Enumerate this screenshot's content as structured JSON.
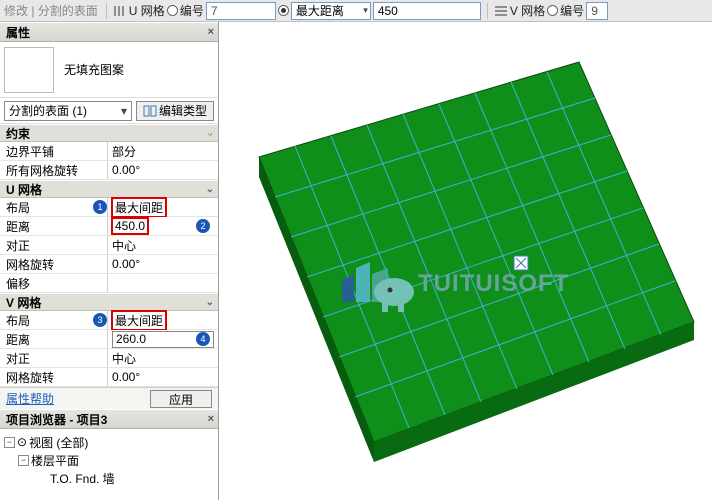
{
  "topbar": {
    "modify": "修改 | 分割的表面",
    "u_label": "U 网格",
    "num_label": "编号",
    "u_num": "7",
    "dist_dd": "最大距离",
    "u_dist": "450",
    "v_label": "V 网格",
    "v_num": "9"
  },
  "props": {
    "title": "属性",
    "pattern": "无填充图案",
    "type_dd": "分割的表面 (1)",
    "edit_type": "编辑类型",
    "sections": {
      "constraint": "约束",
      "ugrid": "U 网格",
      "vgrid": "V 网格"
    },
    "rows": {
      "border_tile_k": "边界平铺",
      "border_tile_v": "部分",
      "all_rot_k": "所有网格旋转",
      "all_rot_v": "0.00°",
      "u_layout_k": "布局",
      "u_layout_v": "最大间距",
      "u_dist_k": "距离",
      "u_dist_v": "450.0",
      "u_align_k": "对正",
      "u_align_v": "中心",
      "u_rot_k": "网格旋转",
      "u_rot_v": "0.00°",
      "u_offset_k": "偏移",
      "v_layout_k": "布局",
      "v_layout_v": "最大间距",
      "v_dist_k": "距离",
      "v_dist_v": "260.0",
      "v_align_k": "对正",
      "v_align_v": "中心",
      "v_rot_k": "网格旋转",
      "v_rot_v": "0.00°"
    },
    "help": "属性帮助",
    "apply": "应用"
  },
  "browser": {
    "title": "项目浏览器 - 项目3",
    "views": "视图 (全部)",
    "floor_plan": "楼层平面",
    "tofnd": "T.O. Fnd. 墙"
  },
  "watermark": "TUITUISOFT",
  "badges": {
    "b1": "1",
    "b2": "2",
    "b3": "3",
    "b4": "4"
  }
}
